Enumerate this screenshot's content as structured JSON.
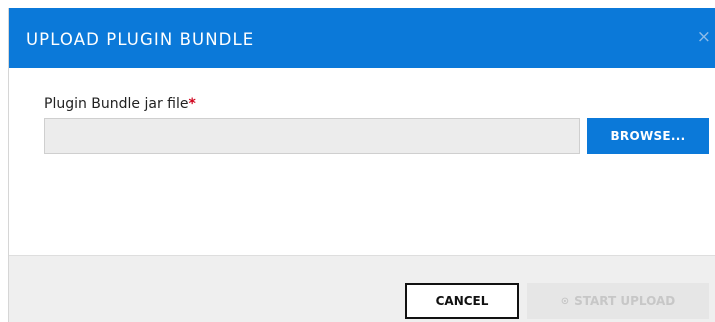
{
  "dialog": {
    "title": "UPLOAD PLUGIN BUNDLE",
    "close_icon": "close-icon",
    "close_glyph": "×"
  },
  "form": {
    "label": "Plugin Bundle jar file",
    "required_marker": "*",
    "file_value": "",
    "browse_label": "BROWSE..."
  },
  "footer": {
    "cancel_label": "CANCEL",
    "upload_icon": "upload-icon",
    "upload_glyph": "⊙",
    "upload_label": "START UPLOAD",
    "upload_disabled": true
  },
  "colors": {
    "header": "#0b79d9",
    "primary_button": "#0b79d9",
    "required": "#d0021b",
    "footer_bg": "#efefef",
    "disabled_button": "#e6e6e6"
  }
}
